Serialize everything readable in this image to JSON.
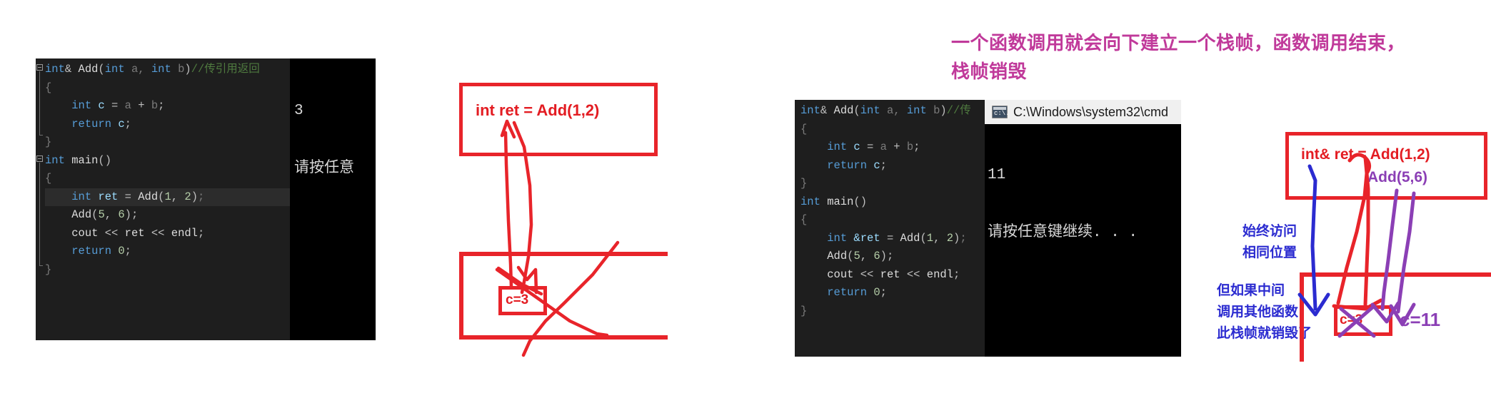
{
  "panel1": {
    "name": "vs-code-editor-left",
    "code_lines": [
      {
        "indent": 0,
        "tokens": [
          {
            "t": "int",
            "c": "kw"
          },
          {
            "t": "& ",
            "c": "punct"
          },
          {
            "t": "Add",
            "c": "plain"
          },
          {
            "t": "(",
            "c": "punct"
          },
          {
            "t": "int",
            "c": "kw"
          },
          {
            "t": " a, ",
            "c": "dim"
          },
          {
            "t": "int",
            "c": "kw"
          },
          {
            "t": " b",
            "c": "dim"
          },
          {
            "t": ")",
            "c": "punct"
          },
          {
            "t": "//传引用返回",
            "c": "cmt"
          }
        ]
      },
      {
        "indent": 0,
        "tokens": [
          {
            "t": "{",
            "c": "dim"
          }
        ]
      },
      {
        "indent": 0,
        "tokens": [
          {
            "t": "    ",
            "c": "plain"
          },
          {
            "t": "int",
            "c": "kw"
          },
          {
            "t": " c ",
            "c": "id"
          },
          {
            "t": "= ",
            "c": "punct"
          },
          {
            "t": "a ",
            "c": "dim"
          },
          {
            "t": "+ ",
            "c": "punct"
          },
          {
            "t": "b",
            "c": "dim"
          },
          {
            "t": ";",
            "c": "punct"
          }
        ]
      },
      {
        "indent": 0,
        "tokens": [
          {
            "t": "    ",
            "c": "plain"
          },
          {
            "t": "return",
            "c": "kw"
          },
          {
            "t": " c",
            "c": "id"
          },
          {
            "t": ";",
            "c": "punct"
          }
        ]
      },
      {
        "indent": 0,
        "tokens": [
          {
            "t": "}",
            "c": "dim"
          }
        ]
      },
      {
        "indent": 0,
        "tokens": [
          {
            "t": "int",
            "c": "kw"
          },
          {
            "t": " main",
            "c": "plain"
          },
          {
            "t": "()",
            "c": "punct"
          }
        ]
      },
      {
        "indent": 0,
        "tokens": [
          {
            "t": "{",
            "c": "dim"
          }
        ]
      },
      {
        "indent": 0,
        "highlight": true,
        "tokens": [
          {
            "t": "    ",
            "c": "plain"
          },
          {
            "t": "int",
            "c": "kw"
          },
          {
            "t": " ret ",
            "c": "id"
          },
          {
            "t": "= ",
            "c": "punct"
          },
          {
            "t": "Add",
            "c": "plain"
          },
          {
            "t": "(",
            "c": "punct"
          },
          {
            "t": "1",
            "c": "num"
          },
          {
            "t": ", ",
            "c": "punct"
          },
          {
            "t": "2",
            "c": "num"
          },
          {
            "t": ")",
            "c": "punct"
          },
          {
            "t": ";",
            "c": "dim"
          }
        ]
      },
      {
        "indent": 0,
        "tokens": [
          {
            "t": "    ",
            "c": "plain"
          },
          {
            "t": "Add",
            "c": "plain"
          },
          {
            "t": "(",
            "c": "punct"
          },
          {
            "t": "5",
            "c": "num"
          },
          {
            "t": ", ",
            "c": "punct"
          },
          {
            "t": "6",
            "c": "num"
          },
          {
            "t": ")",
            "c": "punct"
          },
          {
            "t": ";",
            "c": "punct"
          }
        ]
      },
      {
        "indent": 0,
        "tokens": [
          {
            "t": "    ",
            "c": "plain"
          },
          {
            "t": "cout ",
            "c": "plain"
          },
          {
            "t": "<< ",
            "c": "punct"
          },
          {
            "t": "ret ",
            "c": "plain"
          },
          {
            "t": "<< ",
            "c": "punct"
          },
          {
            "t": "endl",
            "c": "plain"
          },
          {
            "t": ";",
            "c": "punct"
          }
        ]
      },
      {
        "indent": 0,
        "tokens": [
          {
            "t": "    ",
            "c": "plain"
          },
          {
            "t": "return",
            "c": "kw"
          },
          {
            "t": " ",
            "c": "plain"
          },
          {
            "t": "0",
            "c": "num"
          },
          {
            "t": ";",
            "c": "punct"
          }
        ]
      },
      {
        "indent": 0,
        "tokens": [
          {
            "t": "}",
            "c": "dim"
          }
        ]
      }
    ],
    "console": {
      "output_line1": "3",
      "output_line2": "请按任意"
    }
  },
  "panel2": {
    "name": "vs-code-editor-right",
    "code_lines": [
      {
        "tokens": [
          {
            "t": "int",
            "c": "kw"
          },
          {
            "t": "& ",
            "c": "punct"
          },
          {
            "t": "Add",
            "c": "plain"
          },
          {
            "t": "(",
            "c": "punct"
          },
          {
            "t": "int",
            "c": "kw"
          },
          {
            "t": " a, ",
            "c": "dim"
          },
          {
            "t": "int",
            "c": "kw"
          },
          {
            "t": " b",
            "c": "dim"
          },
          {
            "t": ")",
            "c": "punct"
          },
          {
            "t": "//传",
            "c": "cmt"
          }
        ]
      },
      {
        "tokens": [
          {
            "t": "{",
            "c": "dim"
          }
        ]
      },
      {
        "tokens": [
          {
            "t": "    ",
            "c": "plain"
          },
          {
            "t": "int",
            "c": "kw"
          },
          {
            "t": " c ",
            "c": "id"
          },
          {
            "t": "= ",
            "c": "punct"
          },
          {
            "t": "a ",
            "c": "dim"
          },
          {
            "t": "+ ",
            "c": "punct"
          },
          {
            "t": "b",
            "c": "dim"
          },
          {
            "t": ";",
            "c": "punct"
          }
        ]
      },
      {
        "tokens": [
          {
            "t": "    ",
            "c": "plain"
          },
          {
            "t": "return",
            "c": "kw"
          },
          {
            "t": " c",
            "c": "id"
          },
          {
            "t": ";",
            "c": "punct"
          }
        ]
      },
      {
        "tokens": [
          {
            "t": "}",
            "c": "dim"
          }
        ]
      },
      {
        "tokens": [
          {
            "t": "int",
            "c": "kw"
          },
          {
            "t": " main",
            "c": "plain"
          },
          {
            "t": "()",
            "c": "punct"
          }
        ]
      },
      {
        "tokens": [
          {
            "t": "{",
            "c": "dim"
          }
        ]
      },
      {
        "tokens": [
          {
            "t": "    ",
            "c": "plain"
          },
          {
            "t": "int",
            "c": "kw"
          },
          {
            "t": " &ret ",
            "c": "id"
          },
          {
            "t": "= ",
            "c": "punct"
          },
          {
            "t": "Add",
            "c": "plain"
          },
          {
            "t": "(",
            "c": "punct"
          },
          {
            "t": "1",
            "c": "num"
          },
          {
            "t": ", ",
            "c": "punct"
          },
          {
            "t": "2",
            "c": "num"
          },
          {
            "t": ")",
            "c": "punct"
          },
          {
            "t": ";",
            "c": "dim"
          }
        ]
      },
      {
        "tokens": [
          {
            "t": "    ",
            "c": "plain"
          },
          {
            "t": "Add",
            "c": "plain"
          },
          {
            "t": "(",
            "c": "punct"
          },
          {
            "t": "5",
            "c": "num"
          },
          {
            "t": ", ",
            "c": "punct"
          },
          {
            "t": "6",
            "c": "num"
          },
          {
            "t": ")",
            "c": "punct"
          },
          {
            "t": ";",
            "c": "punct"
          }
        ]
      },
      {
        "tokens": [
          {
            "t": "    ",
            "c": "plain"
          },
          {
            "t": "cout ",
            "c": "plain"
          },
          {
            "t": "<< ",
            "c": "punct"
          },
          {
            "t": "ret ",
            "c": "plain"
          },
          {
            "t": "<< ",
            "c": "punct"
          },
          {
            "t": "endl",
            "c": "plain"
          },
          {
            "t": ";",
            "c": "punct"
          }
        ]
      },
      {
        "tokens": [
          {
            "t": "    ",
            "c": "plain"
          },
          {
            "t": "return",
            "c": "kw"
          },
          {
            "t": " ",
            "c": "plain"
          },
          {
            "t": "0",
            "c": "num"
          },
          {
            "t": ";",
            "c": "punct"
          }
        ]
      },
      {
        "tokens": [
          {
            "t": "}",
            "c": "dim"
          }
        ]
      }
    ],
    "console": {
      "title": "C:\\Windows\\system32\\cmd",
      "icon": "cmd-prompt-icon",
      "output_line1": "11",
      "output_line2": "请按任意键继续. . ."
    }
  },
  "diagram_left": {
    "name": "stack-frame-diagram-value-return",
    "top_box_text": "int ret = Add(1,2)",
    "cell_text": "c=3"
  },
  "diagram_right": {
    "name": "stack-frame-diagram-reference-return",
    "top_box_text": "int& ret = Add(1,2)",
    "second_call_text": "Add(5,6)",
    "cell_text": "c=3",
    "cell_text_overwrite": "c=11",
    "blue_note_1_line1": "始终访问",
    "blue_note_1_line2": "相同位置",
    "blue_note_2_line1": "但如果中间",
    "blue_note_2_line2": "调用其他函数",
    "blue_note_2_line3": "此栈帧就销毁了"
  },
  "headline": {
    "line1": "一个函数调用就会向下建立一个栈帧，函数调用结束，",
    "line2": "栈帧销毁"
  },
  "colors": {
    "annotation_red": "#e8242a",
    "annotation_purple": "#8b3fb5",
    "annotation_blue": "#2b2bd0",
    "headline_magenta": "#c0399a",
    "editor_bg": "#1e1e1e",
    "console_bg": "#000000"
  }
}
